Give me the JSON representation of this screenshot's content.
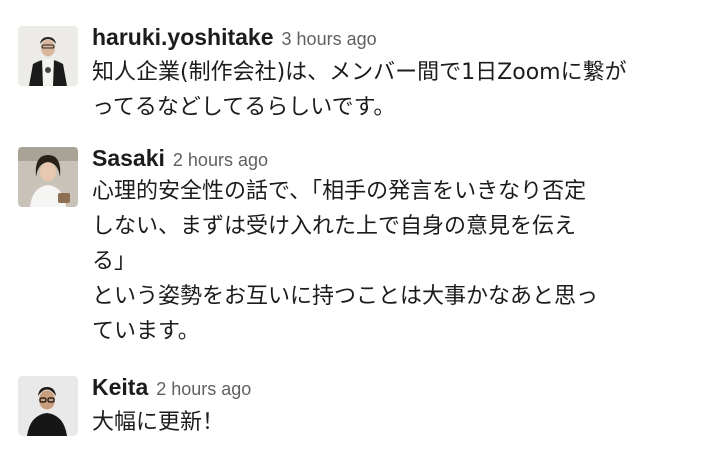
{
  "messages": [
    {
      "author": "haruki.yoshitake",
      "time": "3 hours ago",
      "avatar_icon": "person-avatar-icon",
      "lines": [
        "知人企業(制作会社)は、メンバー間で1日Zoomに繋が",
        "ってるなどしてるらしいです。"
      ]
    },
    {
      "author": "Sasaki",
      "time": "2 hours ago",
      "avatar_icon": "person-avatar-icon",
      "lines": [
        "心理的安全性の話で、「相手の発言をいきなり否定",
        "しない、まずは受け入れた上で自身の意見を伝え",
        "る」",
        "という姿勢をお互いに持つことは大事かなあと思っ",
        "ています。"
      ]
    },
    {
      "author": "Keita",
      "time": "2 hours ago",
      "avatar_icon": "person-avatar-icon",
      "lines": [
        "大幅に更新！"
      ]
    }
  ],
  "colors": {
    "text": "#1d1c1d",
    "timestamp": "#616061",
    "background": "#ffffff"
  }
}
